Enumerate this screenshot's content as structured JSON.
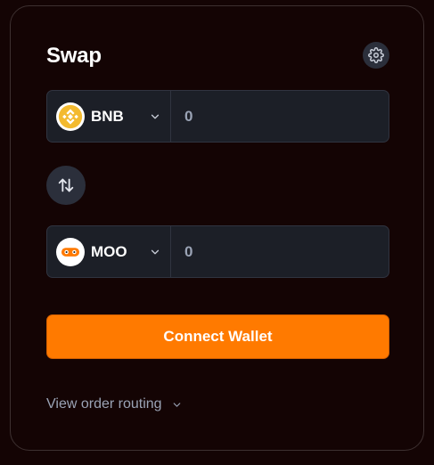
{
  "swap": {
    "title": "Swap",
    "settings_icon": "gear-icon",
    "from": {
      "symbol": "BNB",
      "logo_icon": "bnb-logo-icon",
      "amount_placeholder": "0"
    },
    "switch_icon": "swap-arrows-icon",
    "to": {
      "symbol": "MOO",
      "logo_icon": "moo-logo-icon",
      "amount_placeholder": "0"
    },
    "connect_label": "Connect Wallet",
    "routing_label": "View order routing"
  },
  "colors": {
    "background": "#140404",
    "accent": "#ff7a00",
    "input_bg": "#1c1f27",
    "bnb_yellow": "#f3ba2f",
    "muted_text": "#9aa3b5"
  }
}
